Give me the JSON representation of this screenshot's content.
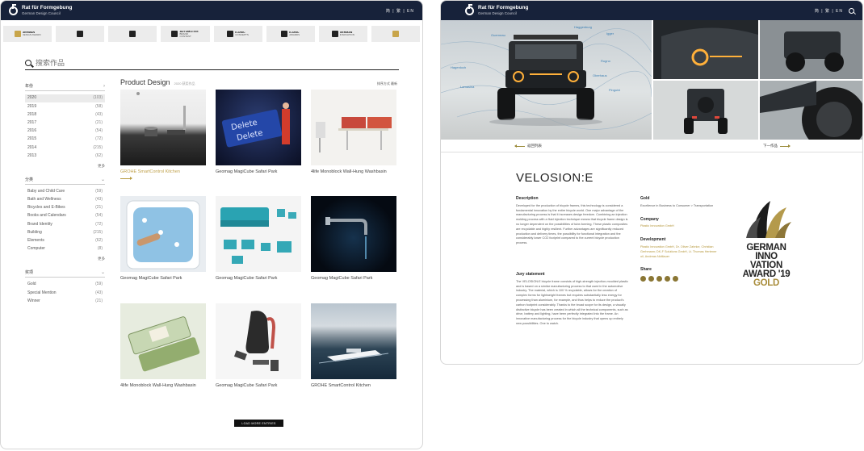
{
  "brand": {
    "name": "Rat für Formgebung",
    "subtitle": "German Design Council",
    "lang": "简 | 繁 | EN"
  },
  "awards": [
    {
      "line1": "GERMAN",
      "line2": "DESIGN AWARD",
      "gold": true
    },
    {
      "line1": "",
      "line2": "",
      "gold": false
    },
    {
      "line1": "",
      "line2": "",
      "gold": false
    },
    {
      "line1": "AUTOMOTIVE",
      "line2": "BRAND CONTEST",
      "gold": false
    },
    {
      "line1": "ICONIC",
      "line2": "CONCEPTS",
      "gold": false
    },
    {
      "line1": "ICONIC",
      "line2": "AWARDS",
      "gold": false
    },
    {
      "line1": "GERMAN",
      "line2": "INNOVATION",
      "gold": false
    },
    {
      "line1": "",
      "line2": "",
      "gold": true
    }
  ],
  "search": {
    "placeholder": "搜索作品"
  },
  "filters": {
    "year": {
      "label": "年份",
      "items": [
        {
          "label": "2020",
          "count": "(103)",
          "selected": true
        },
        {
          "label": "2019",
          "count": "(58)"
        },
        {
          "label": "2018",
          "count": "(43)"
        },
        {
          "label": "2017",
          "count": "(21)"
        },
        {
          "label": "2016",
          "count": "(54)"
        },
        {
          "label": "2015",
          "count": "(72)"
        },
        {
          "label": "2014",
          "count": "(215)"
        },
        {
          "label": "2013",
          "count": "(62)"
        }
      ],
      "more": "更多"
    },
    "category": {
      "label": "分类",
      "items": [
        {
          "label": "Baby and Child Care",
          "count": "(59)"
        },
        {
          "label": "Bath and Wellness",
          "count": "(43)"
        },
        {
          "label": "Bicycles and E-Bikes",
          "count": "(21)"
        },
        {
          "label": "Books and Calendars",
          "count": "(54)"
        },
        {
          "label": "Brand Identity",
          "count": "(72)"
        },
        {
          "label": "Building",
          "count": "(215)"
        },
        {
          "label": "Elements",
          "count": "(62)"
        },
        {
          "label": "Computer",
          "count": "(8)"
        }
      ],
      "more": "更多"
    },
    "prize": {
      "label": "奖项",
      "items": [
        {
          "label": "Gold",
          "count": "(59)"
        },
        {
          "label": "Special Mention",
          "count": "(43)"
        },
        {
          "label": "Winner",
          "count": "(21)"
        }
      ]
    }
  },
  "results": {
    "title": "Product Design",
    "subtitle": "2020 获奖作品",
    "sort": "排序方式   最新",
    "items": [
      {
        "caption": "GROHE SmartControl Kitchen",
        "highlight": true
      },
      {
        "caption": "Geomag MagiCube Safari Park"
      },
      {
        "caption": "4life Monoblock Wall-Hung Washbasin"
      },
      {
        "caption": "Geomag MagiCube Safari Park"
      },
      {
        "caption": "Geomag MagiCube Safari Park"
      },
      {
        "caption": "Geomag MagiCube Safari Park"
      },
      {
        "caption": "4life Monoblock Wall-Hung Washbasin"
      },
      {
        "caption": "Geomag MagiCube Safari Park"
      },
      {
        "caption": "GROHE SmartControl Kitchen"
      }
    ],
    "load_more": "LOAD MORE ENTRIES"
  },
  "detail": {
    "back": "返回列表",
    "next": "下一作品",
    "title": "VELOSION:E",
    "map_labels": [
      "Guerneau",
      "Haggenburg",
      "Igger",
      "Rugno",
      "Hagenloch",
      "Oberhaus",
      "Lamasina",
      "Pinguini"
    ],
    "description_h": "Description",
    "description": "Developed for the production of bicycle frames, this technology is considered a fundamental innovation by the entire bicycle world. One major advantage of the manufacturing process is that it increases design freedom. Combining an injection molding process with a fluid injection technique means that bicycle frame design is no longer dependent on the possibilities of tube-forming. These plastic composites are recyclable and highly resilient. Further advantages are significantly reduced production and delivery times, the possibility for functional integration and the considerably lower CO2 footprint compared to the current bicycle production process.",
    "jury_h": "Jury statement",
    "jury": "The VELOSION:E bicycle frame consists of high-strength injection-moulded plastic and is based on a similar manufacturing process to that used in the automotive industry. The material, which is 100 % recyclable, allows for the creation of complex forms for lightweight frames but requires substantially less energy for processing than aluminium, for example, and thus helps to reduce the product's carbon footprint considerably. Thanks to the broad scope for its design, a visually distinctive bicycle has been created in which all the technical components, such as drive, battery and lighting, have been perfectly integrated into the frame. An innovative manufacturing process for the bicycle industry that opens up entirely new possibilities. One to watch.",
    "gold_h": "Gold",
    "gold_text": "Excellence in Business to Consumer > Transportation",
    "company_h": "Company",
    "company": "Plastic Innovation GmbH",
    "development_h": "Development",
    "development": "Plastic Innovation GmbH, Dr. Oliver Zahnke, Christian Gerhmann; DK-F Solutions GmbH, Lt. Thomas Hertener oil, Andreas Nidtlauer",
    "share_h": "Share",
    "badge": {
      "line1": "GERMAN",
      "line2": "INNO",
      "line3": "VATION",
      "line4": "AWARD '19",
      "line5": "GOLD"
    }
  }
}
